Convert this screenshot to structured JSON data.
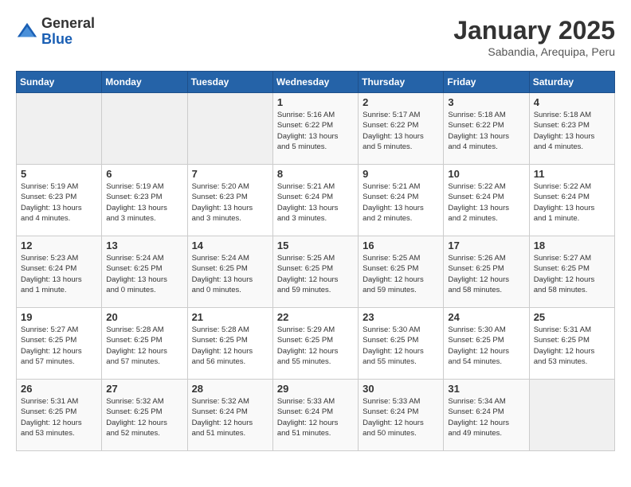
{
  "header": {
    "logo_general": "General",
    "logo_blue": "Blue",
    "month_title": "January 2025",
    "subtitle": "Sabandia, Arequipa, Peru"
  },
  "weekdays": [
    "Sunday",
    "Monday",
    "Tuesday",
    "Wednesday",
    "Thursday",
    "Friday",
    "Saturday"
  ],
  "weeks": [
    [
      {
        "day": "",
        "info": ""
      },
      {
        "day": "",
        "info": ""
      },
      {
        "day": "",
        "info": ""
      },
      {
        "day": "1",
        "info": "Sunrise: 5:16 AM\nSunset: 6:22 PM\nDaylight: 13 hours\nand 5 minutes."
      },
      {
        "day": "2",
        "info": "Sunrise: 5:17 AM\nSunset: 6:22 PM\nDaylight: 13 hours\nand 5 minutes."
      },
      {
        "day": "3",
        "info": "Sunrise: 5:18 AM\nSunset: 6:22 PM\nDaylight: 13 hours\nand 4 minutes."
      },
      {
        "day": "4",
        "info": "Sunrise: 5:18 AM\nSunset: 6:23 PM\nDaylight: 13 hours\nand 4 minutes."
      }
    ],
    [
      {
        "day": "5",
        "info": "Sunrise: 5:19 AM\nSunset: 6:23 PM\nDaylight: 13 hours\nand 4 minutes."
      },
      {
        "day": "6",
        "info": "Sunrise: 5:19 AM\nSunset: 6:23 PM\nDaylight: 13 hours\nand 3 minutes."
      },
      {
        "day": "7",
        "info": "Sunrise: 5:20 AM\nSunset: 6:23 PM\nDaylight: 13 hours\nand 3 minutes."
      },
      {
        "day": "8",
        "info": "Sunrise: 5:21 AM\nSunset: 6:24 PM\nDaylight: 13 hours\nand 3 minutes."
      },
      {
        "day": "9",
        "info": "Sunrise: 5:21 AM\nSunset: 6:24 PM\nDaylight: 13 hours\nand 2 minutes."
      },
      {
        "day": "10",
        "info": "Sunrise: 5:22 AM\nSunset: 6:24 PM\nDaylight: 13 hours\nand 2 minutes."
      },
      {
        "day": "11",
        "info": "Sunrise: 5:22 AM\nSunset: 6:24 PM\nDaylight: 13 hours\nand 1 minute."
      }
    ],
    [
      {
        "day": "12",
        "info": "Sunrise: 5:23 AM\nSunset: 6:24 PM\nDaylight: 13 hours\nand 1 minute."
      },
      {
        "day": "13",
        "info": "Sunrise: 5:24 AM\nSunset: 6:25 PM\nDaylight: 13 hours\nand 0 minutes."
      },
      {
        "day": "14",
        "info": "Sunrise: 5:24 AM\nSunset: 6:25 PM\nDaylight: 13 hours\nand 0 minutes."
      },
      {
        "day": "15",
        "info": "Sunrise: 5:25 AM\nSunset: 6:25 PM\nDaylight: 12 hours\nand 59 minutes."
      },
      {
        "day": "16",
        "info": "Sunrise: 5:25 AM\nSunset: 6:25 PM\nDaylight: 12 hours\nand 59 minutes."
      },
      {
        "day": "17",
        "info": "Sunrise: 5:26 AM\nSunset: 6:25 PM\nDaylight: 12 hours\nand 58 minutes."
      },
      {
        "day": "18",
        "info": "Sunrise: 5:27 AM\nSunset: 6:25 PM\nDaylight: 12 hours\nand 58 minutes."
      }
    ],
    [
      {
        "day": "19",
        "info": "Sunrise: 5:27 AM\nSunset: 6:25 PM\nDaylight: 12 hours\nand 57 minutes."
      },
      {
        "day": "20",
        "info": "Sunrise: 5:28 AM\nSunset: 6:25 PM\nDaylight: 12 hours\nand 57 minutes."
      },
      {
        "day": "21",
        "info": "Sunrise: 5:28 AM\nSunset: 6:25 PM\nDaylight: 12 hours\nand 56 minutes."
      },
      {
        "day": "22",
        "info": "Sunrise: 5:29 AM\nSunset: 6:25 PM\nDaylight: 12 hours\nand 55 minutes."
      },
      {
        "day": "23",
        "info": "Sunrise: 5:30 AM\nSunset: 6:25 PM\nDaylight: 12 hours\nand 55 minutes."
      },
      {
        "day": "24",
        "info": "Sunrise: 5:30 AM\nSunset: 6:25 PM\nDaylight: 12 hours\nand 54 minutes."
      },
      {
        "day": "25",
        "info": "Sunrise: 5:31 AM\nSunset: 6:25 PM\nDaylight: 12 hours\nand 53 minutes."
      }
    ],
    [
      {
        "day": "26",
        "info": "Sunrise: 5:31 AM\nSunset: 6:25 PM\nDaylight: 12 hours\nand 53 minutes."
      },
      {
        "day": "27",
        "info": "Sunrise: 5:32 AM\nSunset: 6:25 PM\nDaylight: 12 hours\nand 52 minutes."
      },
      {
        "day": "28",
        "info": "Sunrise: 5:32 AM\nSunset: 6:24 PM\nDaylight: 12 hours\nand 51 minutes."
      },
      {
        "day": "29",
        "info": "Sunrise: 5:33 AM\nSunset: 6:24 PM\nDaylight: 12 hours\nand 51 minutes."
      },
      {
        "day": "30",
        "info": "Sunrise: 5:33 AM\nSunset: 6:24 PM\nDaylight: 12 hours\nand 50 minutes."
      },
      {
        "day": "31",
        "info": "Sunrise: 5:34 AM\nSunset: 6:24 PM\nDaylight: 12 hours\nand 49 minutes."
      },
      {
        "day": "",
        "info": ""
      }
    ]
  ]
}
